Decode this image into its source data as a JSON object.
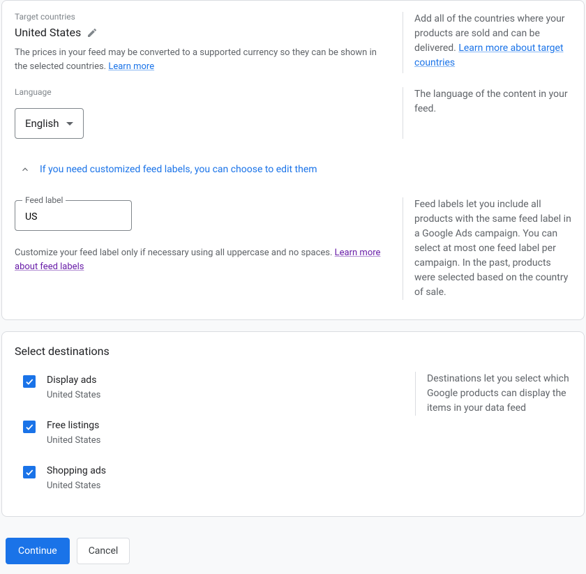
{
  "target_countries": {
    "label": "Target countries",
    "value": "United States",
    "helper": "The prices in your feed may be converted to a supported currency so they can be shown in the selected countries. ",
    "learn_more": "Learn more",
    "side_text": "Add all of the countries where your products are sold and can be delivered. ",
    "side_link": "Learn more about target countries"
  },
  "language": {
    "label": "Language",
    "value": "English",
    "side_text": "The language of the content in your feed."
  },
  "feed_labels_toggle": "If you need customized feed labels, you can choose to edit them",
  "feed_label": {
    "label": "Feed label",
    "value": "US",
    "helper": "Customize your feed label only if necessary using all uppercase and no spaces. ",
    "learn_more": "Learn more about feed labels",
    "side_text": "Feed labels let you include all products with the same feed label in a Google Ads campaign. You can select at most one feed label per campaign. In the past, products were selected based on the country of sale."
  },
  "destinations": {
    "header": "Select destinations",
    "side_text": "Destinations let you select which Google products can display the items in your data feed",
    "items": [
      {
        "label": "Display ads",
        "sub": "United States",
        "checked": true
      },
      {
        "label": "Free listings",
        "sub": "United States",
        "checked": true
      },
      {
        "label": "Shopping ads",
        "sub": "United States",
        "checked": true
      }
    ]
  },
  "buttons": {
    "continue": "Continue",
    "cancel": "Cancel"
  }
}
